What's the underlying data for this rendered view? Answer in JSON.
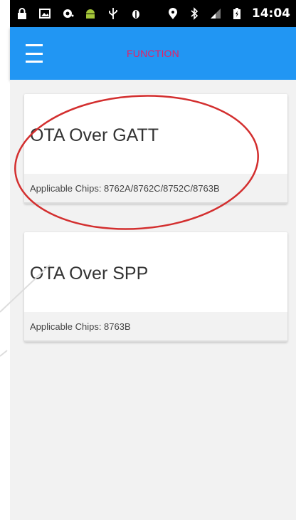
{
  "status_bar": {
    "time": "14:04",
    "icons_left": [
      "lock-icon",
      "image-icon",
      "cast-icon",
      "android-icon",
      "usb-icon",
      "android-debug-icon"
    ],
    "icons_right": [
      "location-icon",
      "bluetooth-icon",
      "signal-icon",
      "battery-icon"
    ]
  },
  "app_bar": {
    "title": "FUNCTION",
    "menu_icon": "menu-icon",
    "background_color": "#2196f3",
    "title_color": "#e91e63"
  },
  "cards": [
    {
      "title": "OTA Over GATT",
      "chips": "Applicable Chips: 8762A/8762C/8752C/8763B"
    },
    {
      "title": "OTA Over SPP",
      "chips": "Applicable Chips: 8763B"
    }
  ],
  "annotation": {
    "shape": "ellipse",
    "color": "#d32f2f",
    "target": "card-1"
  }
}
